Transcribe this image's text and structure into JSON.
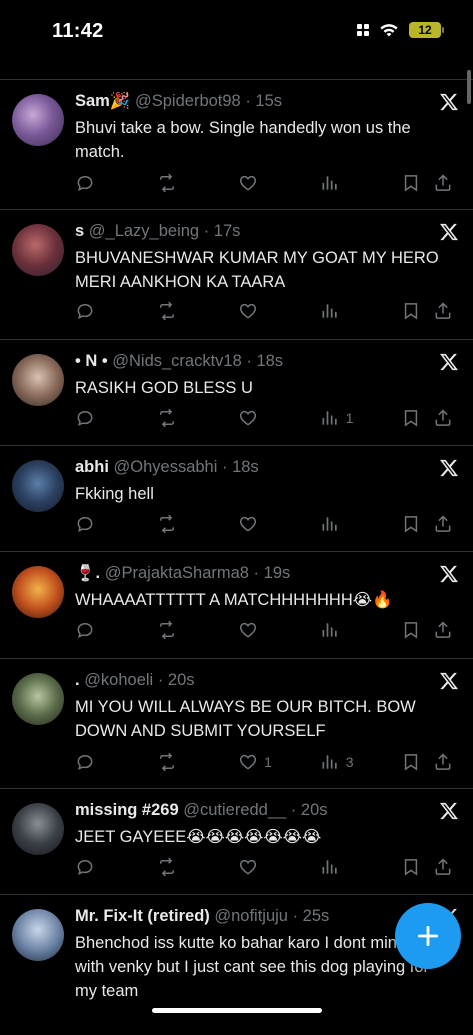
{
  "status_bar": {
    "time": "11:42",
    "battery": "12"
  },
  "tweets": [
    {
      "name": "Sam🎉",
      "handle": "@Spiderbot98",
      "time": "15s",
      "text": "Bhuvi take a bow. Single handedly won us the match.",
      "likes": "",
      "views": ""
    },
    {
      "name": "s",
      "handle": "@_Lazy_being",
      "time": "17s",
      "text": "BHUVANESHWAR KUMAR MY GOAT MY HERO MERI AANKHON KA TAARA",
      "likes": "",
      "views": ""
    },
    {
      "name": "• N •",
      "handle": "@Nids_cracktv18",
      "time": "18s",
      "text": "RASIKH GOD BLESS U",
      "likes": "",
      "views": "1"
    },
    {
      "name": "abhi",
      "handle": "@Ohyessabhi",
      "time": "18s",
      "text": "Fkking hell",
      "likes": "",
      "views": ""
    },
    {
      "name": "🍷.",
      "handle": "@PrajaktaSharma8",
      "time": "19s",
      "text": "WHAAAATTTTTT A MATCHHHHHHH😭🔥",
      "likes": "",
      "views": ""
    },
    {
      "name": ".",
      "handle": "@kohoeli",
      "time": "20s",
      "text": "MI YOU WILL ALWAYS BE OUR BITCH. BOW DOWN AND SUBMIT YOURSELF",
      "likes": "1",
      "views": "3"
    },
    {
      "name": "missing #269",
      "handle": "@cutieredd__",
      "time": "20s",
      "text": "JEET GAYEEE😭😭😭😭😭😭😭",
      "likes": "",
      "views": ""
    },
    {
      "name": "Mr. Fix-It (retired)",
      "handle": "@nofitjuju",
      "time": "25s",
      "text": "Bhenchod iss kutte ko bahar karo I dont mind losing with venky but I just cant see this dog playing for my team",
      "likes": "",
      "views": ""
    }
  ],
  "colors": {
    "accent": "#1d9bf0",
    "muted": "#71767b",
    "divider": "#2f3336"
  },
  "icons": [
    "reply-icon",
    "retweet-icon",
    "like-icon",
    "views-icon",
    "bookmark-icon",
    "share-icon",
    "x-logo-icon",
    "compose-plus-icon"
  ]
}
